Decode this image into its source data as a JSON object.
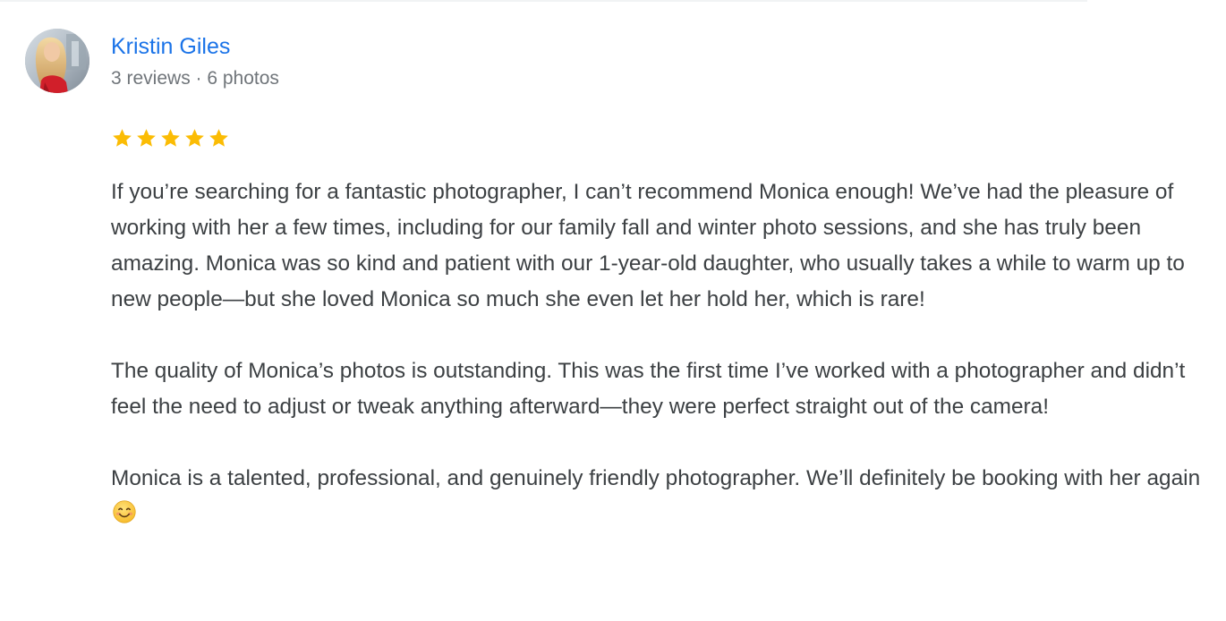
{
  "review": {
    "reviewer": {
      "name": "Kristin Giles",
      "meta": "3 reviews · 6 photos",
      "avatar_icon": "user-photo-avatar"
    },
    "rating": {
      "stars": 5,
      "max": 5,
      "star_color": "#fbbc04"
    },
    "paragraphs": [
      "If you’re searching for a fantastic photographer, I can’t recommend Monica enough! We’ve had the pleasure of working with her a few times, including for our family fall and winter photo sessions, and she has truly been amazing. Monica was so kind and patient with our 1-year-old daughter, who usually takes a while to warm up to new people—but she loved Monica so much she even let her hold her, which is rare!",
      "The quality of Monica’s photos is outstanding. This was the first time I’ve worked with a photographer and didn’t feel the need to adjust or tweak anything afterward—they were perfect straight out of the camera!",
      "Monica is a talented, professional, and genuinely friendly photographer. We’ll definitely be booking with her again"
    ],
    "trailing_emoji": "smiling-face-emoji"
  },
  "colors": {
    "link": "#1a73e8",
    "body_text": "#3c4043",
    "secondary_text": "#70757a",
    "star": "#fbbc04"
  }
}
